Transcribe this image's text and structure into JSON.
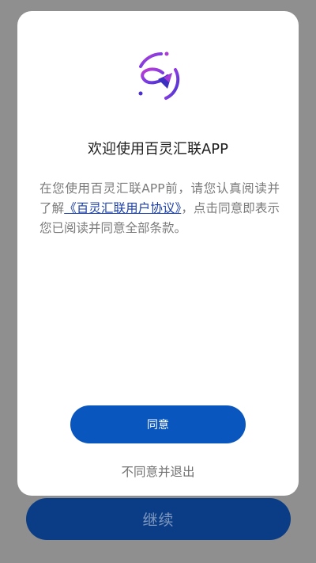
{
  "background_button": {
    "label": "继续",
    "color": "#0b3d86"
  },
  "dialog": {
    "logo_icon": "app-logo-icon",
    "title": "欢迎使用百灵汇联APP",
    "message": {
      "before_link": "在您使用百灵汇联APP前，请您认真阅读并了解",
      "link_text": "《百灵汇联用户协议》",
      "after_link": "，点击同意即表示您已阅读并同意全部条款。"
    },
    "agree_label": "同意",
    "decline_label": "不同意并退出",
    "accent_color": "#0a56bf"
  }
}
